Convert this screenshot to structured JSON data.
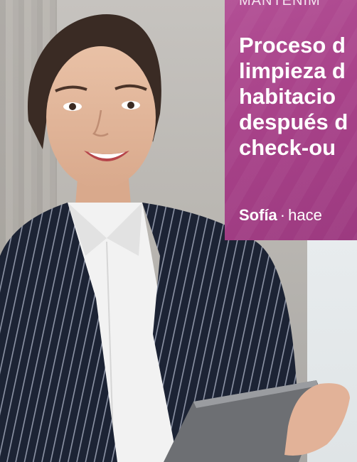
{
  "post": {
    "category": "MANTENIM",
    "title_lines": [
      "Proceso d",
      "limpieza d",
      "habitacio",
      "después d",
      "check-ou"
    ],
    "author": "Sofía",
    "separator": "·",
    "time": "hace"
  },
  "colors": {
    "card_accent": "#a84289",
    "text": "#ffffff"
  }
}
